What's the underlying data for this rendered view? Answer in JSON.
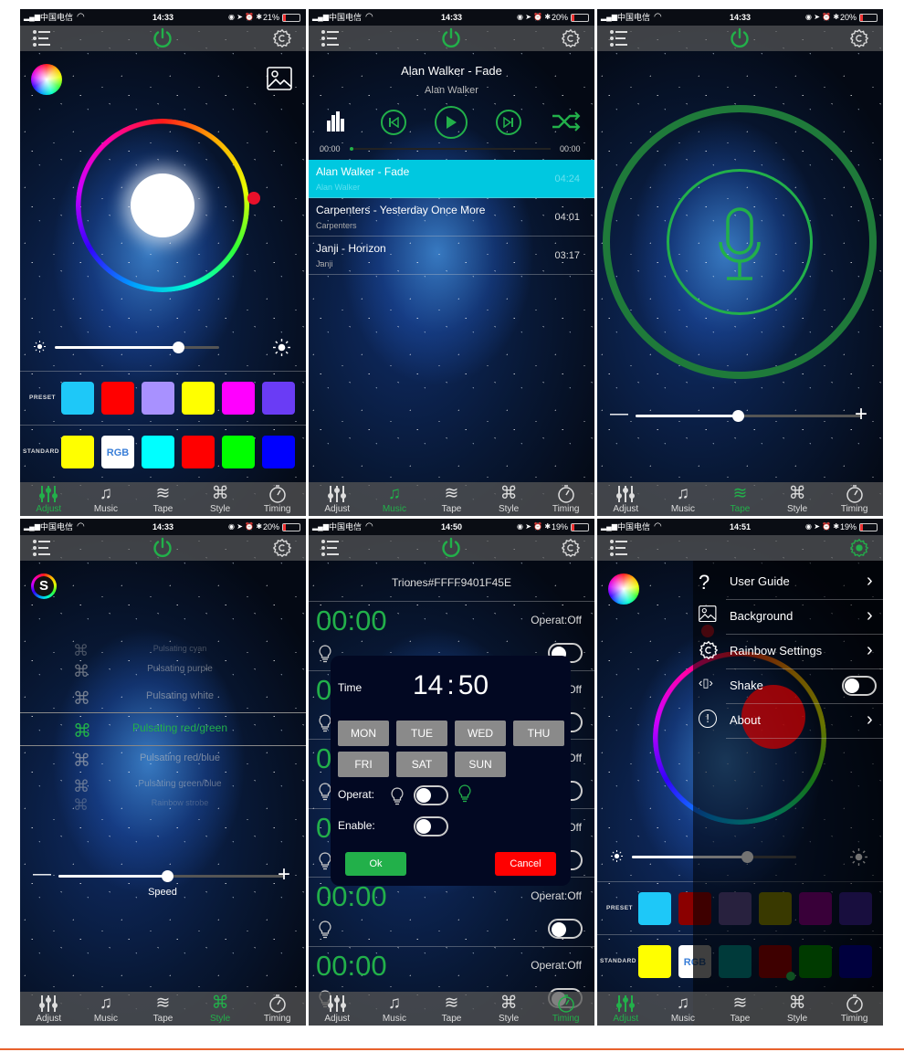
{
  "colors": {
    "accent": "#22b04a",
    "highlight": "#00c8e0",
    "cancel": "#ff0000",
    "ok": "#22b04a"
  },
  "tabs": [
    "Adjust",
    "Music",
    "Tape",
    "Style",
    "Timing"
  ],
  "tab_icons": [
    "sliders-icon",
    "music-note-icon",
    "tape-wave-icon",
    "command-icon",
    "stopwatch-icon"
  ],
  "panels": [
    {
      "status": {
        "carrier": "中国电信",
        "time": "14:33",
        "battery": "21%"
      },
      "active_tab": 0
    },
    {
      "status": {
        "carrier": "中国电信",
        "time": "14:33",
        "battery": "20%"
      },
      "active_tab": 1
    },
    {
      "status": {
        "carrier": "中国电信",
        "time": "14:33",
        "battery": "20%"
      },
      "active_tab": 2
    },
    {
      "status": {
        "carrier": "中国电信",
        "time": "14:33",
        "battery": "20%"
      },
      "active_tab": 3
    },
    {
      "status": {
        "carrier": "中国电信",
        "time": "14:50",
        "battery": "19%"
      },
      "active_tab": 4
    },
    {
      "status": {
        "carrier": "中国电信",
        "time": "14:51",
        "battery": "19%"
      },
      "active_tab": 0
    }
  ],
  "adjust": {
    "brightness": 0.75,
    "preset_label": "PRESET",
    "standard_label": "STANDARD",
    "preset_colors": [
      "#1ec8f8",
      "#ff0000",
      "#a891ff",
      "#ffff00",
      "#ff00ff",
      "#6a3cf5"
    ],
    "standard_colors": [
      "#ffff00",
      "#ffffff",
      "#00ffff",
      "#ff0000",
      "#00ff00",
      "#0000ff"
    ],
    "rgb_label": "RGB"
  },
  "music": {
    "now_playing_title": "Alan Walker - Fade",
    "now_playing_artist": "Alan Walker",
    "elapsed": "00:00",
    "total": "00:00",
    "tracks": [
      {
        "title": "Alan Walker - Fade",
        "artist": "Alan Walker",
        "duration": "04:24",
        "selected": true
      },
      {
        "title": "Carpenters - Yesterday Once More",
        "artist": "Carpenters",
        "duration": "04:01",
        "selected": false
      },
      {
        "title": "Janji - Horizon",
        "artist": "Janji",
        "duration": "03:17",
        "selected": false
      }
    ]
  },
  "tape": {
    "sensitivity": 0.45,
    "minus": "—",
    "plus": "+"
  },
  "style": {
    "modes": [
      "Pulsating cyan",
      "Pulsating purple",
      "Pulsating white",
      "Pulsating red/green",
      "Pulsating red/blue",
      "Pulsating green/blue",
      "Rainbow strobe"
    ],
    "selected_index": 3,
    "speed_label": "Speed",
    "speed": 0.48
  },
  "timing": {
    "device_name": "Triones#FFFF9401F45E",
    "timers": [
      {
        "time": "00:00",
        "status": "Operat:Off"
      },
      {
        "time": "00:00",
        "status": "Operat:Off"
      },
      {
        "time": "00:00",
        "status": "Operat:Off"
      },
      {
        "time": "00:00",
        "status": "Operat:Off"
      },
      {
        "time": "00:00",
        "status": "Operat:Off"
      },
      {
        "time": "00:00",
        "status": "Operat:Off"
      }
    ],
    "dialog": {
      "time_label": "Time",
      "hour": "14",
      "minute": "50",
      "days": [
        "MON",
        "TUE",
        "WED",
        "THU",
        "FRI",
        "SAT",
        "SUN"
      ],
      "operat_label": "Operat:",
      "enable_label": "Enable:",
      "ok_label": "Ok",
      "cancel_label": "Cancel"
    }
  },
  "settings_menu": {
    "items": [
      {
        "label": "User Guide",
        "icon": "question-icon",
        "control": "chevron"
      },
      {
        "label": "Background",
        "icon": "image-icon",
        "control": "chevron"
      },
      {
        "label": "Rainbow Settings",
        "icon": "gear-icon",
        "control": "chevron"
      },
      {
        "label": "Shake",
        "icon": "shake-phone-icon",
        "control": "toggle"
      },
      {
        "label": "About",
        "icon": "info-icon",
        "control": "chevron"
      }
    ],
    "preset_colors": [
      "#1ec8f8",
      "#8b0000",
      "#5a4a8a",
      "#7f7f00",
      "#7f007f",
      "#35218a"
    ],
    "standard_colors": [
      "#ffff00",
      "#ffffff",
      "#008080",
      "#8b0000",
      "#008000",
      "#00008b"
    ]
  }
}
